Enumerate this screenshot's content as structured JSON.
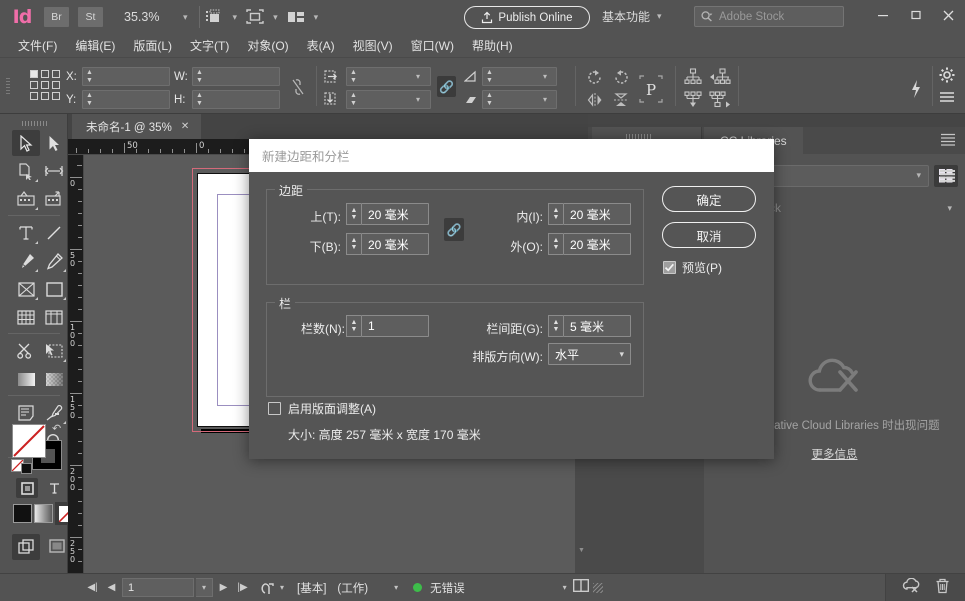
{
  "app": {
    "logo": "Id",
    "bridge_chip": "Br",
    "stock_chip": "St",
    "zoom_level": "35.3%",
    "publish_label": "Publish Online",
    "workspace": "基本功能",
    "stock_placeholder": "Adobe Stock",
    "window_minimize": "—",
    "window_maximize": "❐",
    "window_close": "✕"
  },
  "menu": {
    "items": [
      {
        "label": "文件(F)"
      },
      {
        "label": "编辑(E)"
      },
      {
        "label": "版面(L)"
      },
      {
        "label": "文字(T)"
      },
      {
        "label": "对象(O)"
      },
      {
        "label": "表(A)"
      },
      {
        "label": "视图(V)"
      },
      {
        "label": "窗口(W)"
      },
      {
        "label": "帮助(H)"
      }
    ]
  },
  "control_bar": {
    "x_label": "X:",
    "y_label": "Y:",
    "w_label": "W:",
    "h_label": "H:",
    "x_value": "",
    "y_value": "",
    "w_value": "",
    "h_value": "",
    "rotate_value": "",
    "shear_value": "",
    "scale_x_value": "",
    "scale_y_value": ""
  },
  "document": {
    "tab_title": "未命名-1 @ 35%",
    "tab_close": "✕"
  },
  "rulers": {
    "horizontal_labels": [
      "50",
      "0"
    ],
    "vertical_labels": [
      "0",
      "50",
      "100",
      "150",
      "200",
      "250"
    ]
  },
  "tools": {
    "items": [
      {
        "name": "selection-tool",
        "selected": true
      },
      {
        "name": "direct-selection-tool",
        "selected": false
      },
      {
        "name": "page-tool",
        "selected": false
      },
      {
        "name": "gap-tool",
        "selected": false
      },
      {
        "name": "content-collector-tool",
        "selected": false
      },
      {
        "name": "content-placer-tool",
        "selected": false
      },
      {
        "name": "type-tool",
        "selected": false
      },
      {
        "name": "line-tool",
        "selected": false
      },
      {
        "name": "pen-tool",
        "selected": false
      },
      {
        "name": "pencil-tool",
        "selected": false
      },
      {
        "name": "frame-tool",
        "selected": false
      },
      {
        "name": "rectangle-tool",
        "selected": false
      },
      {
        "name": "table-tool",
        "selected": false
      },
      {
        "name": "column-tool",
        "selected": false
      },
      {
        "name": "scissors-tool",
        "selected": false
      },
      {
        "name": "free-transform-tool",
        "selected": false
      },
      {
        "name": "gradient-swatch-tool",
        "selected": false
      },
      {
        "name": "gradient-feather-tool",
        "selected": false
      },
      {
        "name": "note-tool",
        "selected": false
      },
      {
        "name": "eyedropper-tool",
        "selected": false
      },
      {
        "name": "hand-tool",
        "selected": false
      },
      {
        "name": "zoom-tool",
        "selected": false
      }
    ]
  },
  "dialog": {
    "title": "新建边距和分栏",
    "margins": {
      "group_label": "边距",
      "top_label": "上(T):",
      "top_value": "20 毫米",
      "bottom_label": "下(B):",
      "bottom_value": "20 毫米",
      "inside_label": "内(I):",
      "inside_value": "20 毫米",
      "outside_label": "外(O):",
      "outside_value": "20 毫米",
      "chain_icon": "link-icon"
    },
    "columns": {
      "group_label": "栏",
      "count_label": "栏数(N):",
      "count_value": "1",
      "gutter_label": "栏间距(G):",
      "gutter_value": "5 毫米",
      "direction_label": "排版方向(W):",
      "direction_value": "水平"
    },
    "layout_adjust": {
      "label": "启用版面调整(A)",
      "checked": false
    },
    "size_text": "大小: 高度 257 毫米 x 宽度 170 毫米",
    "ok_label": "确定",
    "cancel_label": "取消",
    "preview_label": "预览(P)",
    "preview_checked": true
  },
  "right_panel": {
    "tab_label": "CC Libraries",
    "library_select_value": "",
    "stock_label": "Adobe Stock",
    "error_text": "加载 Creative Cloud Libraries 时出现问题",
    "more_info_label": "更多信息"
  },
  "status_bar": {
    "page_value": "1",
    "first_icon": "◀|",
    "prev_icon": "◀",
    "next_icon": "▶",
    "last_icon": "|▶",
    "master_label": "[基本]",
    "state_label": "(工作)",
    "preflight_status": "无错误"
  },
  "colors": {
    "chrome": "#535353",
    "panel_dark": "#4a4a4a",
    "accent_pink": "#f06ea9",
    "bleed_guide": "#d46a7a",
    "margin_guide": "#9b8fc0",
    "status_ok": "#3dbd4a",
    "dialog_title_bg": "#ffffff"
  }
}
